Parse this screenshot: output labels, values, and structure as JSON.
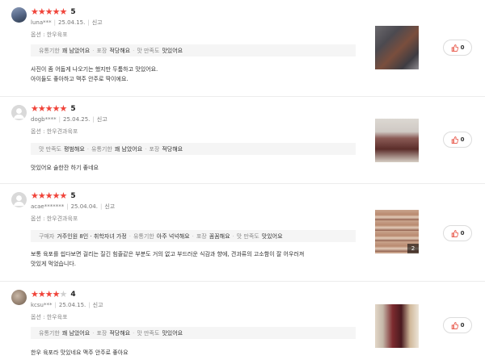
{
  "labels": {
    "report": "신고"
  },
  "reviews": [
    {
      "rating": 5,
      "rating_text": "5",
      "user": "luna***",
      "date": "25.04.15.",
      "option": "옵션 : 한우육포",
      "tags": [
        {
          "k": "유통기한",
          "v": "꽤 남았어요"
        },
        {
          "k": "포장",
          "v": "적당해요"
        },
        {
          "k": "맛 만족도",
          "v": "맛있어요"
        }
      ],
      "text": [
        "사진이 좀 어둡게 나오기는 했지만 두툼하고 맛있어요.",
        "아이들도 좋아하고 맥주 안주로 딱이에요."
      ],
      "photo_count": "",
      "helpful": "0"
    },
    {
      "rating": 5,
      "rating_text": "5",
      "user": "dogb****",
      "date": "25.04.25.",
      "option": "옵션 : 한우견과육포",
      "tags": [
        {
          "k": "맛 만족도",
          "v": "평범해요"
        },
        {
          "k": "유통기한",
          "v": "꽤 남았어요"
        },
        {
          "k": "포장",
          "v": "적당해요"
        }
      ],
      "text": [
        "맛있어요 술한잔 하기 좋네요"
      ],
      "photo_count": "",
      "helpful": "0"
    },
    {
      "rating": 5,
      "rating_text": "5",
      "user": "acae*******",
      "date": "25.04.04.",
      "option": "옵션 : 한우견과육포",
      "tags": [
        {
          "k": "구매자",
          "v": "거주인원 8인 · 취학자녀 가정"
        },
        {
          "k": "유통기한",
          "v": "아주 넉넉해요"
        },
        {
          "k": "포장",
          "v": "꼼꼼해요"
        },
        {
          "k": "맛 만족도",
          "v": "맛있어요"
        }
      ],
      "text": [
        "보통 육포를 씹다보면 걸리는 질긴 힘줄같은 부분도 거의 없고 부드러운 식감과 향에, 견과류의 고소함이 잘 어우러져",
        "맛있게 먹었습니다."
      ],
      "photo_count": "2",
      "helpful": "0"
    },
    {
      "rating": 4,
      "rating_text": "4",
      "user": "kcsu***",
      "date": "25.04.15.",
      "option": "옵션 : 한우육포",
      "tags": [
        {
          "k": "유통기한",
          "v": "꽤 남았어요"
        },
        {
          "k": "포장",
          "v": "적당해요"
        },
        {
          "k": "맛 만족도",
          "v": "맛있어요"
        }
      ],
      "text": [
        "한우 육포라 맛있네요 맥주 안주로 좋아요"
      ],
      "photo_count": "",
      "helpful": "0"
    }
  ]
}
